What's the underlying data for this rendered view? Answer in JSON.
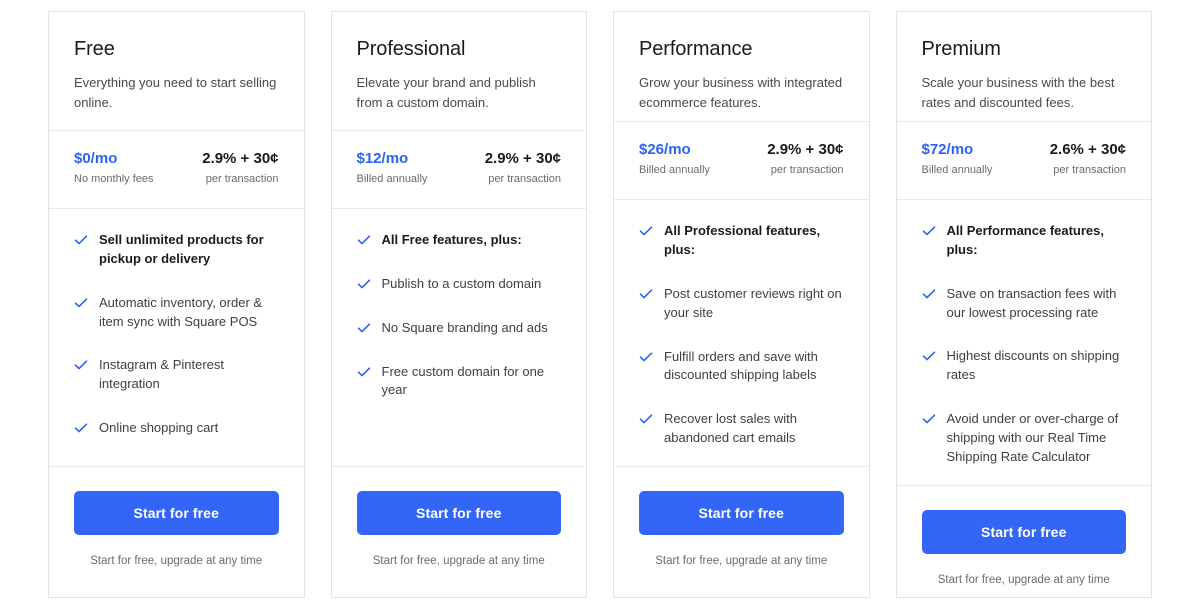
{
  "theme": {
    "accent_blue": "#3366f6",
    "price_blue": "#2a62f5",
    "border_gray": "#e3e3e3",
    "text_dark": "#1b1b1b",
    "text_muted": "#6b6b6b"
  },
  "plans": [
    {
      "name": "Free",
      "tagline": "Everything you need to start selling online.",
      "price": "$0/mo",
      "price_note": "No monthly fees",
      "rate": "2.9% + 30¢",
      "rate_note": "per transaction",
      "features": [
        {
          "text": "Sell unlimited products for pickup or delivery",
          "bold": true
        },
        {
          "text": "Automatic inventory, order & item sync with Square POS",
          "bold": false
        },
        {
          "text": "Instagram & Pinterest integration",
          "bold": false
        },
        {
          "text": "Online shopping cart",
          "bold": false
        }
      ],
      "cta_label": "Start for free",
      "cta_note": "Start for free, upgrade at any time"
    },
    {
      "name": "Professional",
      "tagline": "Elevate your brand and publish from a custom domain.",
      "price": "$12/mo",
      "price_note": "Billed annually",
      "rate": "2.9% + 30¢",
      "rate_note": "per transaction",
      "features": [
        {
          "text": "All Free features, plus:",
          "bold": true
        },
        {
          "text": "Publish to a custom domain",
          "bold": false
        },
        {
          "text": "No Square branding and ads",
          "bold": false
        },
        {
          "text": "Free custom domain for one year",
          "bold": false
        }
      ],
      "cta_label": "Start for free",
      "cta_note": "Start for free, upgrade at any time"
    },
    {
      "name": "Performance",
      "tagline": "Grow your business with integrated ecommerce features.",
      "price": "$26/mo",
      "price_note": "Billed annually",
      "rate": "2.9% + 30¢",
      "rate_note": "per transaction",
      "features": [
        {
          "text": "All Professional features, plus:",
          "bold": true
        },
        {
          "text": "Post customer reviews right on your site",
          "bold": false
        },
        {
          "text": "Fulfill orders and save with discounted shipping labels",
          "bold": false
        },
        {
          "text": "Recover lost sales with abandoned cart emails",
          "bold": false
        }
      ],
      "cta_label": "Start for free",
      "cta_note": "Start for free, upgrade at any time"
    },
    {
      "name": "Premium",
      "tagline": "Scale your business with the best rates and discounted fees.",
      "price": "$72/mo",
      "price_note": "Billed annually",
      "rate": "2.6% + 30¢",
      "rate_note": "per transaction",
      "features": [
        {
          "text": "All Performance features, plus:",
          "bold": true
        },
        {
          "text": "Save on transaction fees with our lowest processing rate",
          "bold": false
        },
        {
          "text": "Highest discounts on shipping rates",
          "bold": false
        },
        {
          "text": "Avoid under or over-charge of shipping with our Real Time Shipping Rate Calculator",
          "bold": false
        }
      ],
      "cta_label": "Start for free",
      "cta_note": "Start for free, upgrade at any time"
    }
  ],
  "icons": {
    "check": "check-icon"
  }
}
